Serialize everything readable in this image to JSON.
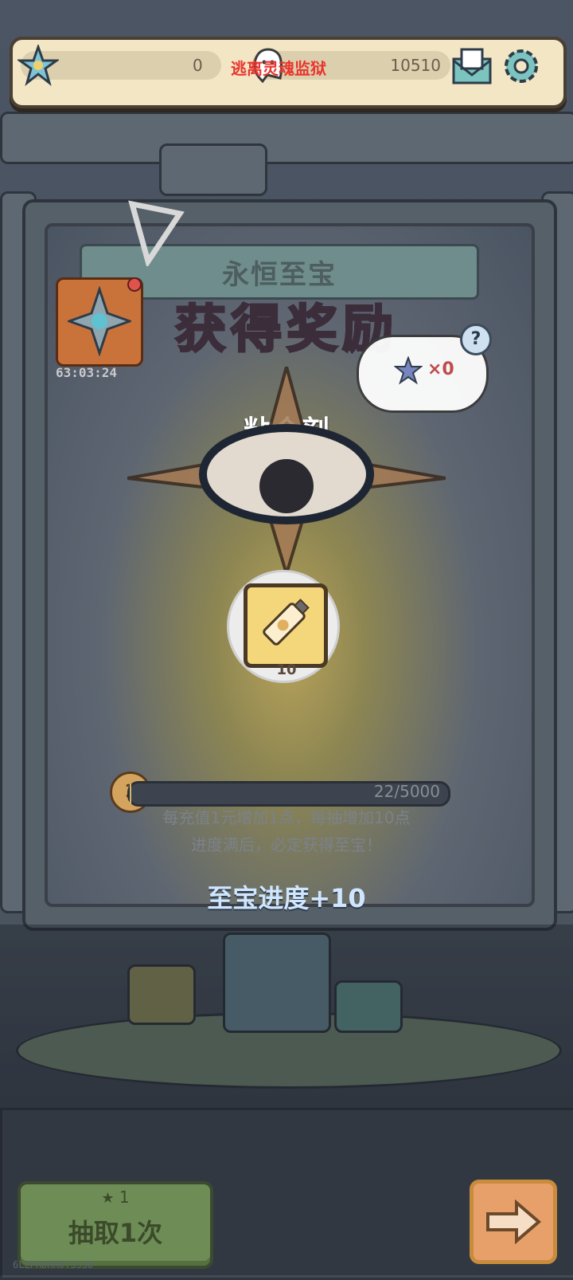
{
  "app_title": "逃离灵魂监狱",
  "top_bar": {
    "star_count": "0",
    "ghost_count": "10510",
    "mail_icon": "mail-envelope-icon",
    "settings_icon": "gear-icon"
  },
  "event": {
    "timer": "63:03:24"
  },
  "panel": {
    "treasure_title": "永恒至宝",
    "reward_title": "获得奖励",
    "item_name": "粘合剂",
    "item_quantity": "10",
    "bubble_count": "×0",
    "help_label": "?",
    "level": "1",
    "progress_text": "22/5000",
    "progress": {
      "current": 22,
      "max": 5000
    },
    "note_line1": "每充值1元增加1点，每抽增加10点",
    "note_line2": "进度满后，必定获得至宝！",
    "bonus_text": "至宝进度+10"
  },
  "bottom": {
    "draw_cost": "1",
    "draw_label": "抽取1次",
    "next_icon": "arrow-right-icon"
  },
  "footer_code": "6LZPHDRROT3S30",
  "colors": {
    "accent_red": "#e8362f",
    "bonus_blue": "#cfe6ff",
    "draw_green": "#6e8c56",
    "next_orange": "#e7a06a"
  }
}
